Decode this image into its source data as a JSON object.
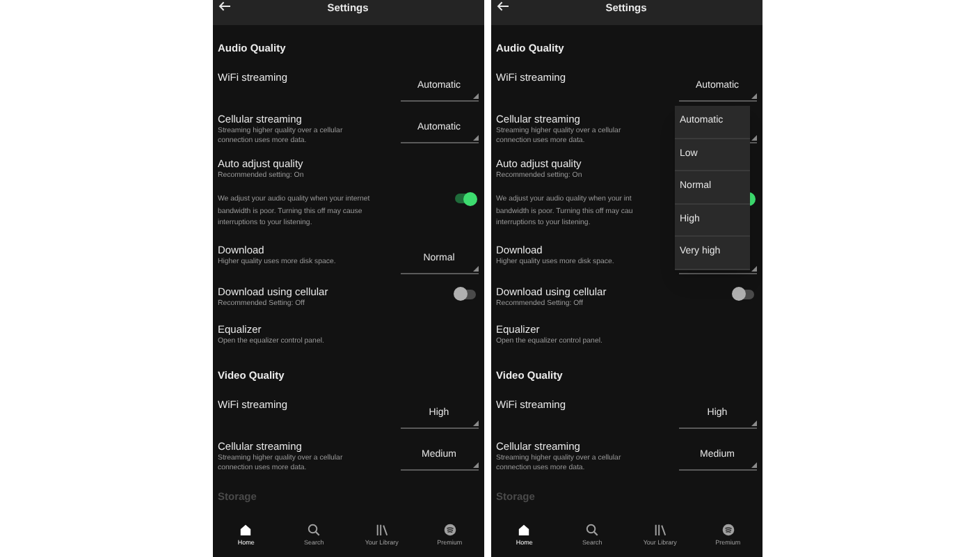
{
  "screens": [
    {
      "title": "Settings",
      "sections": [
        {
          "heading": "Audio Quality",
          "dimmed": false,
          "items": [
            {
              "kind": "select",
              "label": "WiFi streaming",
              "value": "Automatic"
            },
            {
              "kind": "select",
              "label": "Cellular streaming",
              "description": "Streaming higher quality over a cellular\nconnection uses more data.",
              "value": "Automatic"
            },
            {
              "kind": "toggle",
              "label": "Auto adjust quality",
              "description": "Recommended setting: On",
              "note": "We adjust your audio quality when your internet\nbandwidth is poor. Turning this off may cause\ninterruptions to your listening.",
              "on": true
            },
            {
              "kind": "select",
              "label": "Download",
              "description": "Higher quality uses more disk space.",
              "value": "Normal"
            },
            {
              "kind": "toggle",
              "label": "Download using cellular",
              "description": "Recommended Setting: Off",
              "on": false
            },
            {
              "kind": "link",
              "label": "Equalizer",
              "description": "Open the equalizer control panel."
            }
          ]
        },
        {
          "heading": "Video Quality",
          "dimmed": false,
          "items": [
            {
              "kind": "select",
              "label": "WiFi streaming",
              "value": "High"
            },
            {
              "kind": "select",
              "label": "Cellular streaming",
              "description": "Streaming higher quality over a cellular\nconnection uses more data.",
              "value": "Medium"
            }
          ]
        },
        {
          "heading": "Storage",
          "dimmed": true
        }
      ],
      "nav": [
        {
          "label": "Home",
          "selected": true
        },
        {
          "label": "Search",
          "selected": false
        },
        {
          "label": "Your Library",
          "selected": false
        },
        {
          "label": "Premium",
          "selected": false
        }
      ]
    },
    {
      "title": "Settings",
      "sections": [
        {
          "heading": "Audio Quality",
          "dimmed": false,
          "items": [
            {
              "kind": "select",
              "label": "WiFi streaming",
              "value": "Automatic",
              "options": [
                "Automatic",
                "Low",
                "Normal",
                "High",
                "Very high"
              ]
            },
            {
              "kind": "select",
              "label": "Cellular streaming",
              "description": "Streaming higher quality over a cellular\nconnection uses more data."
            },
            {
              "kind": "toggle",
              "label": "Auto adjust quality",
              "description": "Recommended setting: On",
              "note": "We adjust your audio quality when your int\nbandwidth is poor. Turning this off may cau\ninterruptions to your listening.",
              "on": true
            },
            {
              "kind": "select",
              "label": "Download",
              "description": "Higher quality uses more disk space."
            },
            {
              "kind": "toggle",
              "label": "Download using cellular",
              "description": "Recommended Setting: Off",
              "on": false
            },
            {
              "kind": "link",
              "label": "Equalizer",
              "description": "Open the equalizer control panel."
            }
          ]
        },
        {
          "heading": "Video Quality",
          "dimmed": false,
          "items": [
            {
              "kind": "select",
              "label": "WiFi streaming",
              "value": "High"
            },
            {
              "kind": "select",
              "label": "Cellular streaming",
              "description": "Streaming higher quality over a cellular\nconnection uses more data.",
              "value": "Medium"
            }
          ]
        },
        {
          "heading": "Storage",
          "dimmed": true
        }
      ],
      "nav": [
        {
          "label": "Home",
          "selected": true
        },
        {
          "label": "Search",
          "selected": false
        },
        {
          "label": "Your Library",
          "selected": false
        },
        {
          "label": "Premium",
          "selected": false
        }
      ]
    }
  ]
}
